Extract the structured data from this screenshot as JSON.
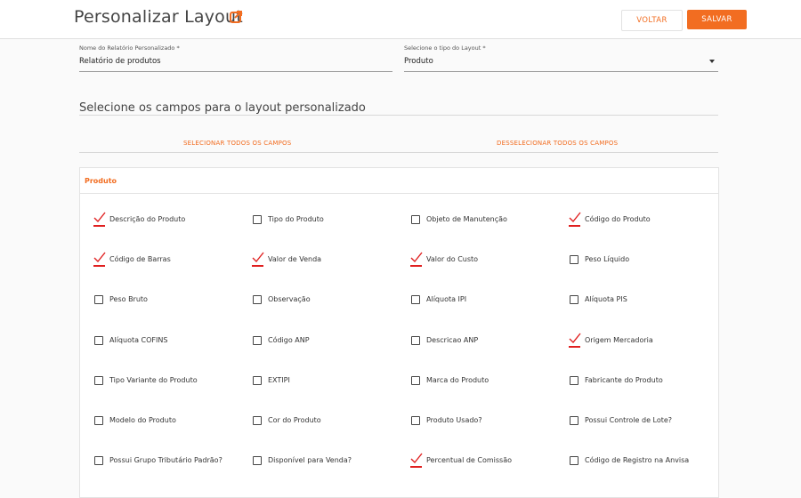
{
  "header": {
    "title": "Personalizar Layout",
    "voltar_label": "VOLTAR",
    "salvar_label": "SALVAR"
  },
  "form": {
    "report_name": {
      "label": "Nome do Relatório Personalizado *",
      "value": "Relatório de produtos"
    },
    "layout_type": {
      "label": "Selecione o tipo do Layout *",
      "value": "Produto"
    }
  },
  "fields_section": {
    "title": "Selecione os campos para o layout personalizado",
    "select_all": "SELECIONAR TODOS OS CAMPOS",
    "deselect_all": "DESSELECIONAR TODOS OS CAMPOS"
  },
  "panel": {
    "title": "Produto",
    "items": [
      {
        "label": "Descrição do Produto",
        "checked": true
      },
      {
        "label": "Tipo do Produto",
        "checked": false
      },
      {
        "label": "Objeto de Manutenção",
        "checked": false
      },
      {
        "label": "Código do Produto",
        "checked": true
      },
      {
        "label": "Código de Barras",
        "checked": true
      },
      {
        "label": "Valor de Venda",
        "checked": true
      },
      {
        "label": "Valor do Custo",
        "checked": true
      },
      {
        "label": "Peso Líquido",
        "checked": false
      },
      {
        "label": "Peso Bruto",
        "checked": false
      },
      {
        "label": "Observação",
        "checked": false
      },
      {
        "label": "Alíquota IPI",
        "checked": false
      },
      {
        "label": "Alíquota PIS",
        "checked": false
      },
      {
        "label": "Alíquota COFINS",
        "checked": false
      },
      {
        "label": "Código ANP",
        "checked": false
      },
      {
        "label": "Descricao ANP",
        "checked": false
      },
      {
        "label": "Origem Mercadoria",
        "checked": true
      },
      {
        "label": "Tipo Variante do Produto",
        "checked": false
      },
      {
        "label": "EXTIPI",
        "checked": false
      },
      {
        "label": "Marca do Produto",
        "checked": false
      },
      {
        "label": "Fabricante do Produto",
        "checked": false
      },
      {
        "label": "Modelo do Produto",
        "checked": false
      },
      {
        "label": "Cor do Produto",
        "checked": false
      },
      {
        "label": "Produto Usado?",
        "checked": false
      },
      {
        "label": "Possui Controle de Lote?",
        "checked": false
      },
      {
        "label": "Possui Grupo Tributário Padrão?",
        "checked": false
      },
      {
        "label": "Disponível para Venda?",
        "checked": false
      },
      {
        "label": "Percentual de Comissão",
        "checked": true
      },
      {
        "label": "Código de Registro na Anvisa",
        "checked": false
      }
    ]
  },
  "colors": {
    "accent": "#f26d21",
    "check_underline": "#e02020"
  }
}
